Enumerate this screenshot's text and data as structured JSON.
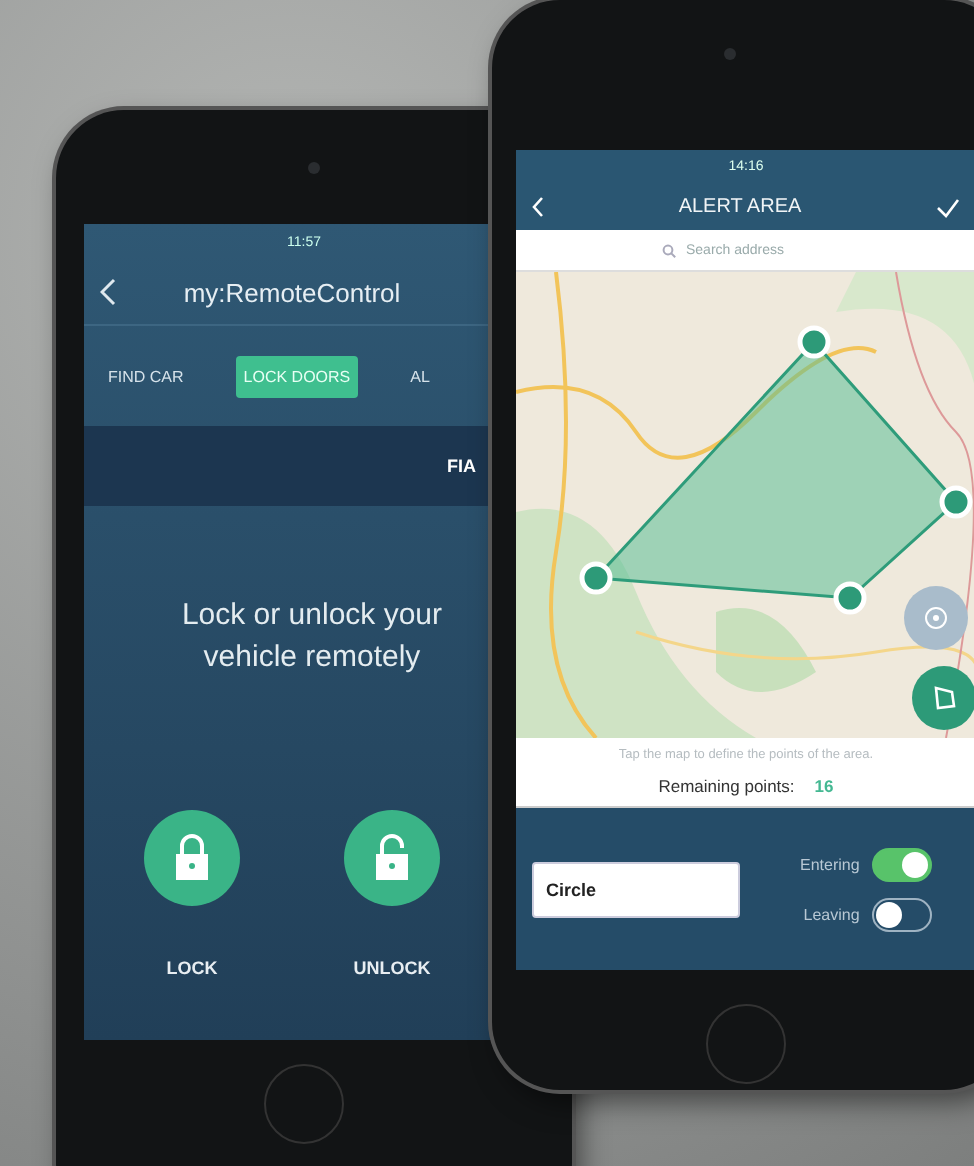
{
  "remote_control_phone": {
    "status_time": "11:57",
    "title": "my:RemoteControl",
    "tabs": [
      {
        "label": "FIND CAR",
        "selected": false
      },
      {
        "label": "LOCK DOORS",
        "selected": true
      },
      {
        "label": "AL",
        "selected": false
      }
    ],
    "vehicle": "FIA",
    "headline": "Lock or unlock your vehicle remotely",
    "actions": [
      {
        "kind": "lock",
        "label": "LOCK"
      },
      {
        "kind": "unlock",
        "label": "UNLOCK"
      }
    ]
  },
  "alert_area_phone": {
    "status_time": "14:16",
    "title": "ALERT AREA",
    "search": {
      "placeholder": "Search address"
    },
    "hint": "Tap the map to define the points of the area.",
    "remaining_label": "Remaining points:",
    "remaining_value": "16",
    "shape_field": {
      "value": "Circle"
    },
    "toggles": [
      {
        "label": "Entering",
        "on": true
      },
      {
        "label": "Leaving",
        "on": false
      }
    ]
  }
}
